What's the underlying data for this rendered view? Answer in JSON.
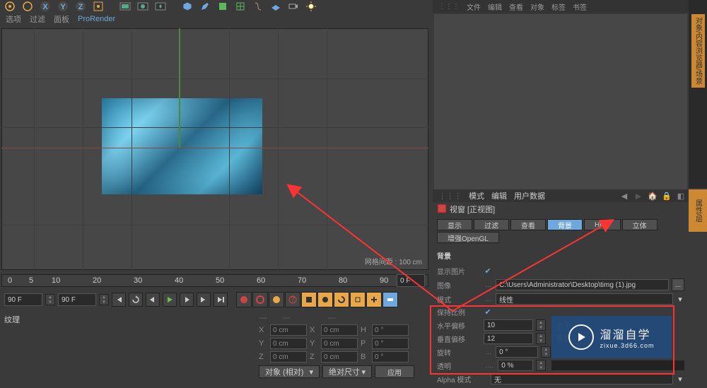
{
  "toolbar": {
    "icons": [
      "orbit-icon",
      "orbit2-icon",
      "x-icon",
      "y-icon",
      "z-icon",
      "pivot-icon",
      "divider",
      "render-icon",
      "render-region-icon",
      "render-settings-icon",
      "divider",
      "cube-icon",
      "tool1-icon",
      "tool2-icon",
      "lattice-icon",
      "bend-icon",
      "floor-icon",
      "camera-icon",
      "light-icon"
    ]
  },
  "menu": {
    "items": [
      "选项",
      "过滤",
      "面板"
    ],
    "active": "ProRender"
  },
  "viewport": {
    "grid_label": "网格间距 : 100 cm"
  },
  "ruler": {
    "marks": [
      "0",
      "5",
      "10",
      "20",
      "30",
      "40",
      "50",
      "60",
      "70",
      "80",
      "90"
    ],
    "end_field": "0 F"
  },
  "transport": {
    "frame_start": "90 F",
    "frame_end": "90 F"
  },
  "bottom_panel": {
    "texture_label": "纹理",
    "xyz": {
      "rows": [
        {
          "axis": "X",
          "v1": "0 cm",
          "v2": "H",
          "v2v": "0 °"
        },
        {
          "axis": "Y",
          "v1": "0 cm",
          "v2": "P",
          "v2v": "0 °"
        },
        {
          "axis": "Z",
          "v1": "0 cm",
          "v2": "B",
          "v2v": "0 °"
        }
      ],
      "x2": "X",
      "x2v": "0 cm",
      "y2": "Y",
      "y2v": "0 cm",
      "z2": "Z",
      "z2v": "0 cm"
    },
    "dropdown1": "对象 (相对)",
    "dropdown2": "绝对尺寸",
    "apply_btn": "应用",
    "dashes": "---"
  },
  "right_top": {
    "menu": [
      "文件",
      "编辑",
      "查看",
      "对象",
      "标签",
      "书签"
    ]
  },
  "right_bottom": {
    "menu": [
      "模式",
      "编辑",
      "用户数据"
    ],
    "title_icon": "viewport-icon",
    "title": "视窗 [正视图]",
    "tabs": [
      "显示",
      "过滤",
      "查看",
      "背景",
      "HUD",
      "立体",
      "增强OpenGL"
    ],
    "active_tab": "背景",
    "section_label": "背景",
    "props": {
      "show_image": "显示图片",
      "image": "图像",
      "image_path": "C:\\Users\\Administrator\\Desktop\\timg (1).jpg",
      "mode": "模式",
      "mode_val": "线性",
      "keep_ratio": "保持比例",
      "h_offset": "水平偏移",
      "h_offset_val": "10",
      "h_label2": "水平",
      "v_offset": "垂直偏移",
      "v_offset_val": "12",
      "v_label2": "垂直",
      "rotation": "旋转",
      "rotation_val": "0 °",
      "opacity": "透明",
      "opacity_val": "0 %",
      "alpha_mode": "Alpha 模式",
      "alpha_val": "无"
    }
  },
  "side_tabs": [
    "对象/内容浏览器/场景",
    "属性/层"
  ],
  "watermark": {
    "title": "溜溜自学",
    "url": "zixue.3d66.com"
  }
}
